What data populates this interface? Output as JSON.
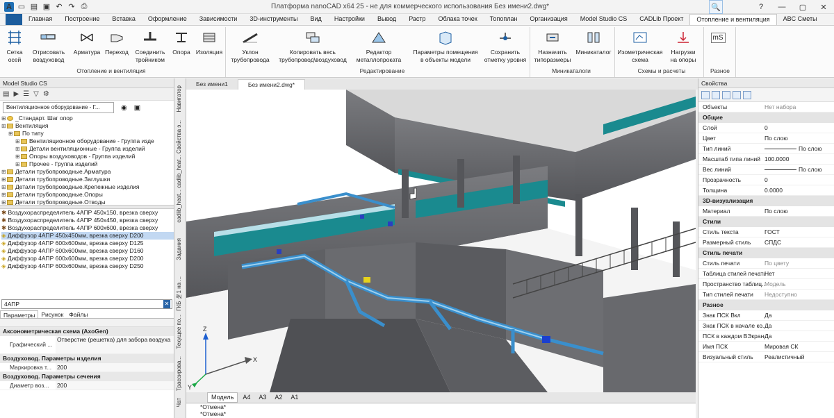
{
  "window": {
    "title": "Платформа nanoCAD x64 25 - не для коммерческого использования Без имени2.dwg*",
    "app_icon": "А"
  },
  "ribbon_tabs": [
    "Главная",
    "Построение",
    "Вставка",
    "Оформление",
    "Зависимости",
    "3D-инструменты",
    "Вид",
    "Настройки",
    "Вывод",
    "Растр",
    "Облака точек",
    "Топоплан",
    "Организация",
    "Model Studio CS",
    "CADLib Проект",
    "Отопление и вентиляция",
    "ABC Сметы"
  ],
  "active_tab": "Отопление и вентиляция",
  "ribbon": {
    "btn_grid": "Сетка\nосей",
    "btn_draw_duct": "Отрисовать\nвоздуховод",
    "btn_armatura": "Арматура",
    "btn_perehod": "Переход",
    "btn_soedinit": "Соединить\nтройником",
    "btn_opora": "Опора",
    "btn_izolyaciya": "Изоляция",
    "group1": "Отопление и вентиляция",
    "btn_uklon": "Уклон\nтрубопровода",
    "btn_copy": "Копировать весь\nтрубопровод\\воздуховод",
    "btn_editor": "Редактор\nметаллопроката",
    "btn_params": "Параметры помещения\nв объекты модели",
    "btn_save_level": "Сохранить\nотметку уровня",
    "group2": "Редактирование",
    "btn_naznachit": "Назначить\nтипоразмеры",
    "btn_minicatalog": "Миникаталог",
    "group3": "Миникаталоги",
    "btn_iso": "Изометрическая\nсхема",
    "btn_loads": "Нагрузки\nна опоры",
    "group4": "Схемы и расчеты",
    "btn_ms": "mS",
    "group5": "Разное"
  },
  "left_panel": {
    "title": "Model Studio CS",
    "combo": "Вентиляционное оборудование - Г...",
    "tree": [
      {
        "indent": 0,
        "label": "_Стандарт. Шаг опор",
        "icon": "star"
      },
      {
        "indent": 0,
        "label": "Вентиляция",
        "icon": "folder"
      },
      {
        "indent": 1,
        "label": "По типу",
        "icon": "folder"
      },
      {
        "indent": 2,
        "label": "Вентиляционное оборудование - Группа изде",
        "icon": "folder"
      },
      {
        "indent": 2,
        "label": "Детали вентиляционные - Группа изделий",
        "icon": "folder"
      },
      {
        "indent": 2,
        "label": "Опоры воздуховодов - Группа изделий",
        "icon": "folder"
      },
      {
        "indent": 2,
        "label": "Прочее - Группа изделий",
        "icon": "folder"
      },
      {
        "indent": 0,
        "label": "Детали трубопроводные.Арматура",
        "icon": "folder"
      },
      {
        "indent": 0,
        "label": "Детали трубопроводные.Заглушки",
        "icon": "folder"
      },
      {
        "indent": 0,
        "label": "Детали трубопроводные.Крепежные изделия",
        "icon": "folder"
      },
      {
        "indent": 0,
        "label": "Детали трубопроводные.Опоры",
        "icon": "folder"
      },
      {
        "indent": 0,
        "label": "Детали трубопроводные.Отводы",
        "icon": "folder"
      },
      {
        "indent": 0,
        "label": "Детали трубопроводные.Переходы",
        "icon": "folder"
      },
      {
        "indent": 0,
        "label": "Детали трубопроводные.Тройники",
        "icon": "folder"
      }
    ],
    "items": [
      "Воздухораспределитель 4АПР 450x150, врезка сверху",
      "Воздухораспределитель 4АПР 450x450, врезка сверху",
      "Воздухораспределитель 4АПР 600x600, врезка сверху",
      "Диффузор 4АПР 450x450мм, врезка сверху D200",
      "Диффузор 4АПР 600x600мм, врезка сверху D125",
      "Диффузор 4АПР 600x600мм, врезка сверху D160",
      "Диффузор 4АПР 600x600мм, врезка сверху D200",
      "Диффузор 4АПР 600x600мм, врезка сверху D250"
    ],
    "selected_index": 3,
    "search": "4АПР",
    "subtabs": [
      "Параметры",
      "Рисунок",
      "Файлы"
    ],
    "params": {
      "sec1": "Аксонометрическая схема (AxoGen)",
      "row1_k": "Графический ...",
      "row1_v": "Отверстие (решетка) для забора воздуха",
      "sec2": "Воздуховод. Параметры изделия",
      "row2_k": "Маркировка т...",
      "row2_v": "200",
      "sec3": "Воздуховод. Параметры сечения",
      "row3_k": "Диаметр воз...",
      "row3_v": "200"
    }
  },
  "side_tabs": [
    "Навигатор",
    "Свойства э...",
    "cadlib_heat...",
    "cadlib_heat...",
    "Задания",
    "ГКБ №1 на ...",
    "Текущее по...",
    "Трассирова...",
    "Чат"
  ],
  "doc_tabs": [
    "Без имени1",
    "Без имени2.dwg*"
  ],
  "active_doc": 1,
  "layout_tabs": [
    "Модель",
    "A4",
    "A3",
    "A2",
    "A1"
  ],
  "command_lines": [
    "*Отмена*",
    "*Отмена*"
  ],
  "axes": {
    "x": "X",
    "y": "Y",
    "z": "Z"
  },
  "colors": {
    "accent": "#1c5d9d",
    "duct": "#3a8fcc",
    "wall": "#6e6f72",
    "window": "#1a8a8f"
  },
  "properties": {
    "title": "Свойства",
    "objects_k": "Объекты",
    "objects_v": "Нет набора",
    "sec_general": "Общие",
    "rows_general": [
      {
        "k": "Слой",
        "v": "0"
      },
      {
        "k": "Цвет",
        "v": "По слою"
      },
      {
        "k": "Тип линий",
        "v": "По слою"
      },
      {
        "k": "Масштаб типа линий",
        "v": "100.0000"
      },
      {
        "k": "Вес линий",
        "v": "По слою"
      },
      {
        "k": "Прозрачность",
        "v": "0"
      },
      {
        "k": "Толщина",
        "v": "0.0000"
      }
    ],
    "sec_3d": "3D-визуализация",
    "rows_3d": [
      {
        "k": "Материал",
        "v": "По слою"
      }
    ],
    "sec_styles": "Стили",
    "rows_styles": [
      {
        "k": "Стиль текста",
        "v": "ГОСТ"
      },
      {
        "k": "Размерный стиль",
        "v": "СПДС"
      }
    ],
    "sec_print": "Стиль печати",
    "rows_print": [
      {
        "k": "Стиль печати",
        "v": "По цвету",
        "gray": true
      },
      {
        "k": "Таблица стилей печати",
        "v": "Нет"
      },
      {
        "k": "Пространство таблиц...",
        "v": "Модель",
        "gray": true
      },
      {
        "k": "Тип стилей печати",
        "v": "Недоступно",
        "gray": true
      }
    ],
    "sec_misc": "Разное",
    "rows_misc": [
      {
        "k": "Знак ПСК Вкл",
        "v": "Да"
      },
      {
        "k": "Знак ПСК в начале ко...",
        "v": "Да"
      },
      {
        "k": "ПСК в каждом ВЭкране",
        "v": "Да"
      },
      {
        "k": "Имя ПСК",
        "v": "Мировая СК"
      },
      {
        "k": "Визуальный стиль",
        "v": "Реалистичный"
      }
    ]
  }
}
